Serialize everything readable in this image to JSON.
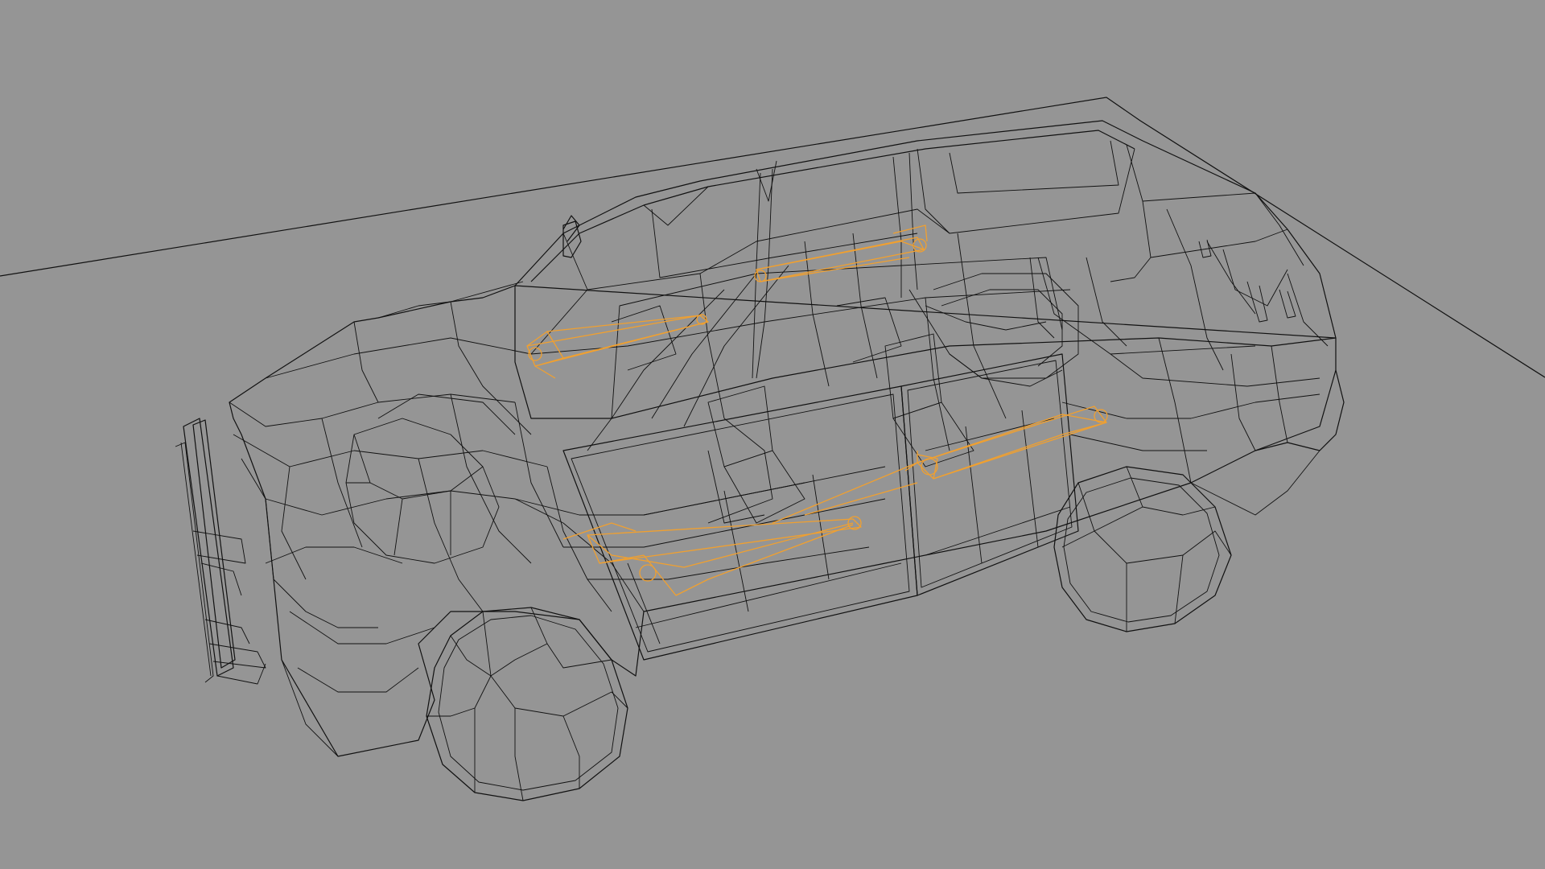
{
  "viewport": {
    "background": "#959595",
    "mode": "wireframe",
    "wire_color": "#111111",
    "armature_color": "#f0a030"
  },
  "scene": {
    "object": "suv-wireframe-model",
    "armature": "rig-bones"
  }
}
